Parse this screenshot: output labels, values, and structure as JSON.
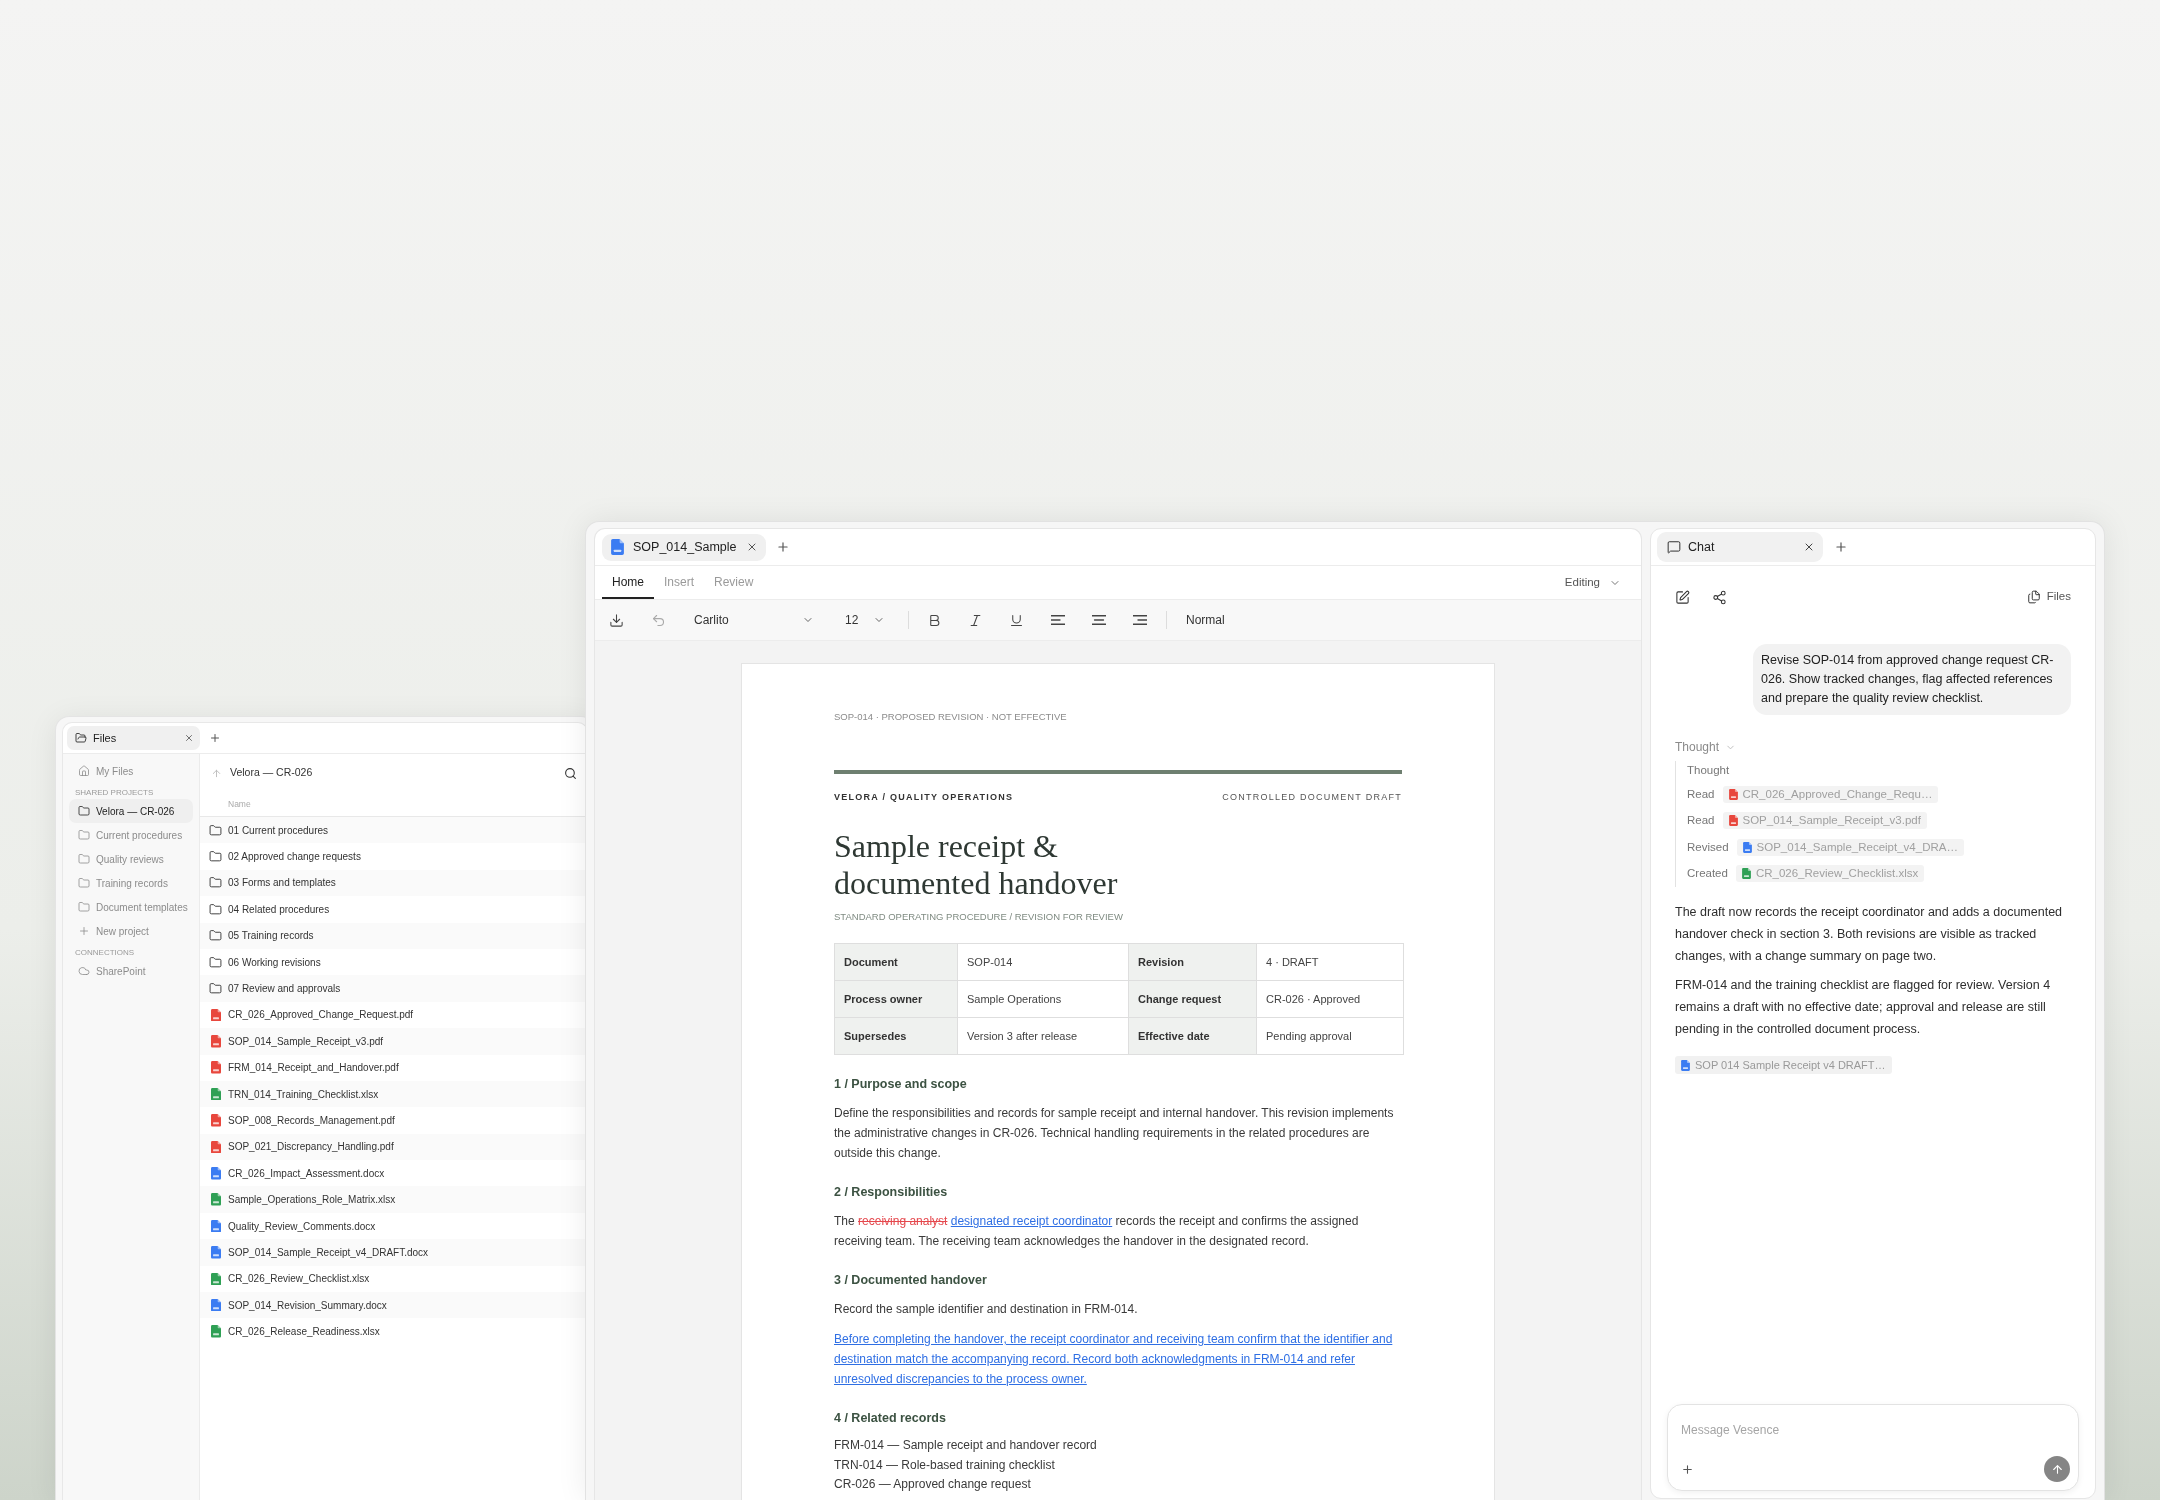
{
  "files_window": {
    "tab": {
      "title": "Files"
    },
    "sidebar": {
      "top_item": {
        "kind": "home",
        "label": "My Files",
        "selected": false
      },
      "sections": [
        {
          "title": "SHARED PROJECTS",
          "items": [
            {
              "kind": "folder",
              "label": "Velora — CR-026",
              "selected": true
            },
            {
              "kind": "folder",
              "label": "Current procedures",
              "selected": false
            },
            {
              "kind": "folder",
              "label": "Quality reviews",
              "selected": false
            },
            {
              "kind": "folder",
              "label": "Training records",
              "selected": false
            },
            {
              "kind": "folder",
              "label": "Document templates",
              "selected": false
            },
            {
              "kind": "add",
              "label": "New project",
              "selected": false
            }
          ]
        },
        {
          "title": "CONNECTIONS",
          "items": [
            {
              "kind": "cloud",
              "label": "SharePoint",
              "selected": false
            }
          ]
        }
      ]
    },
    "path": "Velora — CR-026",
    "column_header": "Name",
    "rows": [
      {
        "name": "01 Current procedures",
        "kind": "folder"
      },
      {
        "name": "02 Approved change requests",
        "kind": "folder"
      },
      {
        "name": "03 Forms and templates",
        "kind": "folder"
      },
      {
        "name": "04 Related procedures",
        "kind": "folder"
      },
      {
        "name": "05 Training records",
        "kind": "folder"
      },
      {
        "name": "06 Working revisions",
        "kind": "folder"
      },
      {
        "name": "07 Review and approvals",
        "kind": "folder"
      },
      {
        "name": "CR_026_Approved_Change_Request.pdf",
        "kind": "pdf"
      },
      {
        "name": "SOP_014_Sample_Receipt_v3.pdf",
        "kind": "pdf"
      },
      {
        "name": "FRM_014_Receipt_and_Handover.pdf",
        "kind": "pdf"
      },
      {
        "name": "TRN_014_Training_Checklist.xlsx",
        "kind": "xlsx"
      },
      {
        "name": "SOP_008_Records_Management.pdf",
        "kind": "pdf"
      },
      {
        "name": "SOP_021_Discrepancy_Handling.pdf",
        "kind": "pdf"
      },
      {
        "name": "CR_026_Impact_Assessment.docx",
        "kind": "docx"
      },
      {
        "name": "Sample_Operations_Role_Matrix.xlsx",
        "kind": "xlsx"
      },
      {
        "name": "Quality_Review_Comments.docx",
        "kind": "docx"
      },
      {
        "name": "SOP_014_Sample_Receipt_v4_DRAFT.docx",
        "kind": "docx"
      },
      {
        "name": "CR_026_Review_Checklist.xlsx",
        "kind": "xlsx"
      },
      {
        "name": "SOP_014_Revision_Summary.docx",
        "kind": "docx"
      },
      {
        "name": "CR_026_Release_Readiness.xlsx",
        "kind": "xlsx"
      }
    ]
  },
  "editor": {
    "tab": {
      "title": "SOP_014_Sample",
      "kind": "docx"
    },
    "ribbon_tabs": [
      {
        "label": "Home",
        "selected": true
      },
      {
        "label": "Insert",
        "selected": false
      },
      {
        "label": "Review",
        "selected": false
      }
    ],
    "mode": "Editing",
    "toolbar": {
      "font": "Carlito",
      "size": "12",
      "style": "Normal"
    },
    "document": {
      "running_header": "SOP-014 · PROPOSED REVISION · NOT EFFECTIVE",
      "org": "VELORA / QUALITY OPERATIONS",
      "status": "CONTROLLED DOCUMENT DRAFT",
      "title": "Sample receipt & documented handover",
      "subtitle": "STANDARD OPERATING PROCEDURE / REVISION FOR REVIEW",
      "meta_table": [
        [
          {
            "label": "Document",
            "value": "SOP-014"
          },
          {
            "label": "Revision",
            "value": "4 · DRAFT"
          }
        ],
        [
          {
            "label": "Process owner",
            "value": "Sample Operations"
          },
          {
            "label": "Change request",
            "value": "CR-026 · Approved"
          }
        ],
        [
          {
            "label": "Supersedes",
            "value": "Version 3 after release"
          },
          {
            "label": "Effective date",
            "value": "Pending approval"
          }
        ]
      ],
      "sections": [
        {
          "heading": "1 / Purpose and scope",
          "blocks": [
            {
              "kind": "paragraph",
              "segments": [
                {
                  "kind": "text",
                  "text": "Define the responsibilities and records for sample receipt and internal handover. This revision implements the administrative changes in CR-026. Technical handling requirements in the related procedures are outside this change."
                }
              ]
            }
          ]
        },
        {
          "heading": "2 / Responsibilities",
          "blocks": [
            {
              "kind": "paragraph",
              "segments": [
                {
                  "kind": "text",
                  "text": "The"
                },
                {
                  "kind": "deleted",
                  "text": "receiving analyst"
                },
                {
                  "kind": "inserted",
                  "text": "designated receipt coordinator"
                },
                {
                  "kind": "text",
                  "text": "records the receipt and confirms the assigned receiving team. The receiving team acknowledges the handover in the designated record."
                }
              ]
            }
          ]
        },
        {
          "heading": "3 / Documented handover",
          "blocks": [
            {
              "kind": "paragraph",
              "segments": [
                {
                  "kind": "text",
                  "text": "Record the sample identifier and destination in FRM-014."
                }
              ]
            },
            {
              "kind": "paragraph",
              "segments": [
                {
                  "kind": "inserted",
                  "text": "Before completing the handover, the receipt coordinator and receiving team confirm that the identifier and destination match the accompanying record. Record both acknowledgments in FRM-014 and refer unresolved discrepancies to the process owner."
                }
              ]
            }
          ]
        },
        {
          "heading": "4 / Related records",
          "blocks": [
            {
              "kind": "list",
              "items": [
                "FRM-014 — Sample receipt and handover record",
                "TRN-014 — Role-based training checklist",
                "CR-026 — Approved change request"
              ]
            }
          ]
        }
      ]
    }
  },
  "chat": {
    "tab": {
      "title": "Chat"
    },
    "files_label": "Files",
    "user_message": "Revise SOP-014 from approved change request CR-026. Show tracked changes, flag affected references and prepare the quality review checklist.",
    "thought": {
      "label": "Thought",
      "steps": [
        {
          "kind": "note",
          "text": "Thought"
        },
        {
          "kind": "file",
          "action": "Read",
          "file": {
            "name": "CR_026_Approved_Change_Requ…",
            "kind": "pdf"
          }
        },
        {
          "kind": "file",
          "action": "Read",
          "file": {
            "name": "SOP_014_Sample_Receipt_v3.pdf",
            "kind": "pdf"
          }
        },
        {
          "kind": "file",
          "action": "Revised",
          "file": {
            "name": "SOP_014_Sample_Receipt_v4_DRA…",
            "kind": "docx"
          }
        },
        {
          "kind": "file",
          "action": "Created",
          "file": {
            "name": "CR_026_Review_Checklist.xlsx",
            "kind": "xlsx"
          }
        }
      ]
    },
    "reply": [
      "The draft now records the receipt coordinator and adds a documented handover check in section 3. Both revisions are visible as tracked changes, with a change summary on page two.",
      "FRM-014 and the training checklist are flagged for review. Version 4 remains a draft with no effective date; approval and release are still pending in the controlled document process."
    ],
    "attachment": {
      "name": "SOP 014 Sample Receipt v4 DRAFT…",
      "kind": "docx"
    },
    "composer": {
      "placeholder": "Message Vesence"
    }
  }
}
